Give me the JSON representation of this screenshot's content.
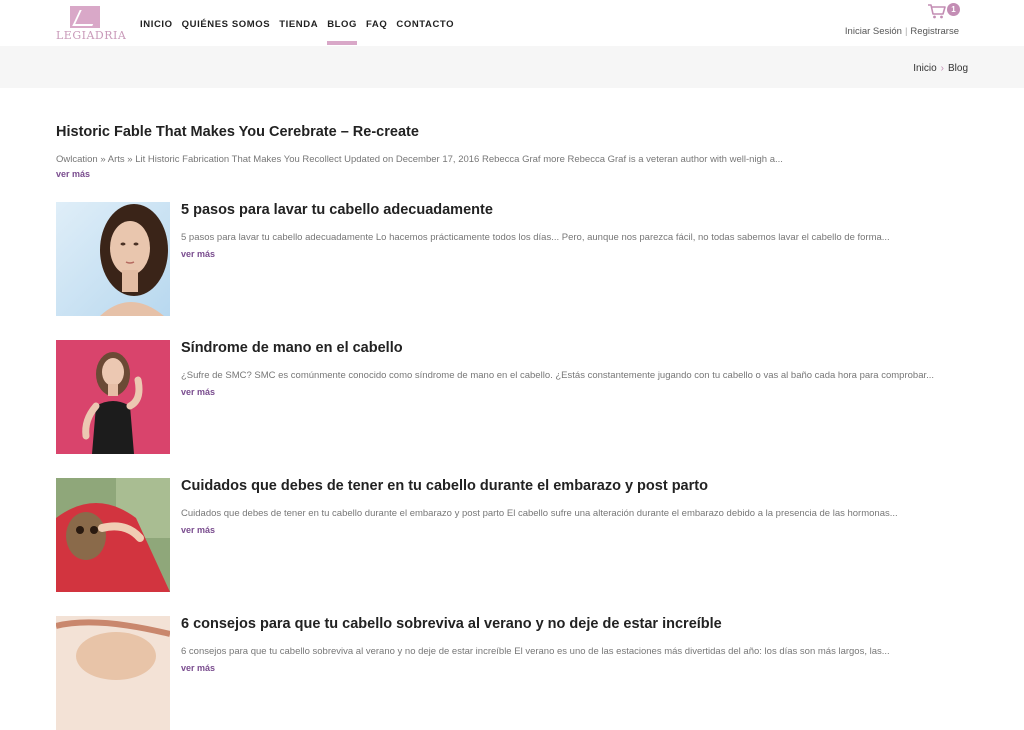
{
  "brand": {
    "logo_text": "LEGIADRIA"
  },
  "nav": [
    {
      "label": "INICIO"
    },
    {
      "label": "QUIÉNES SOMOS"
    },
    {
      "label": "TIENDA"
    },
    {
      "label": "BLOG"
    },
    {
      "label": "FAQ"
    },
    {
      "label": "CONTACTO"
    }
  ],
  "cart": {
    "icon": "cart-icon",
    "count": "1"
  },
  "auth": {
    "login": "Iniciar Sesión",
    "separator": "|",
    "register": "Registrarse"
  },
  "breadcrumb": {
    "home": "Inicio",
    "arrow": "›",
    "current": "Blog"
  },
  "first_post": {
    "title": "Historic Fable That Makes You Cerebrate – Re-create",
    "excerpt": "Owlcation » Arts » Lit Historic Fabrication That Makes You Recollect Updated on December 17, 2016 Rebecca Graf more Rebecca Graf is a veteran author with well-nigh a...",
    "more": "ver más"
  },
  "posts": [
    {
      "title": "5 pasos para lavar tu cabello adecuadamente",
      "excerpt": "5 pasos para lavar tu cabello adecuadamente Lo hacemos prácticamente todos los días... Pero, aunque nos parezca fácil, no todas sabemos lavar el cabello de forma...",
      "more": "ver más"
    },
    {
      "title": "Síndrome de mano en el cabello",
      "excerpt": "¿Sufre de SMC? SMC es comúnmente conocido como síndrome de mano en el cabello. ¿Estás constantemente jugando con tu cabello o vas al baño cada hora para comprobar...",
      "more": "ver más"
    },
    {
      "title": "Cuidados que debes de tener en tu cabello durante el embarazo y post parto",
      "excerpt": "Cuidados que debes de tener en tu cabello durante el embarazo y post parto El cabello sufre una alteración durante el embarazo debido a la presencia de las hormonas...",
      "more": "ver más"
    },
    {
      "title": "6 consejos para que tu cabello sobreviva al verano y no deje de estar increíble",
      "excerpt": "6 consejos para que tu cabello sobreviva al verano y no deje de estar increíble El verano es uno de las estaciones más divertidas del año: los días son más largos, las...",
      "more": "ver más"
    }
  ],
  "colors": {
    "accent": "#d9a8c8",
    "link": "#7a4d8f",
    "badge": "#c38db4"
  }
}
